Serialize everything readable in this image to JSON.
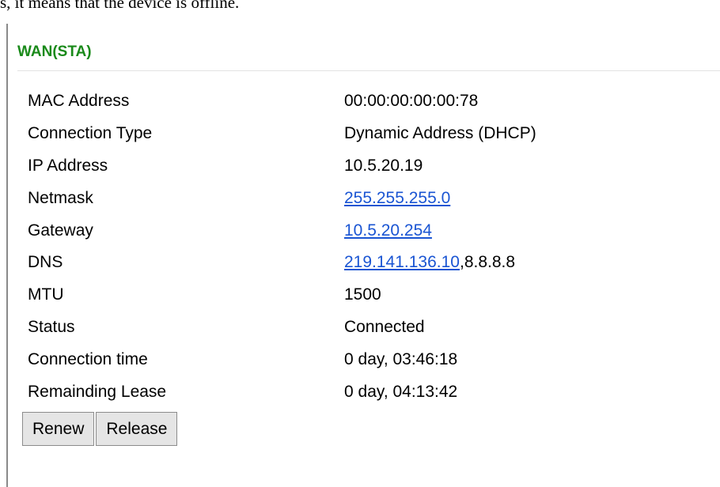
{
  "header_text": "s, it means that the device is offline.",
  "section": {
    "title": "WAN(STA)"
  },
  "rows": [
    {
      "label": "MAC Address",
      "value": "00:00:00:00:00:78"
    },
    {
      "label": "Connection Type",
      "value": "Dynamic Address (DHCP)"
    },
    {
      "label": "IP Address",
      "value": "10.5.20.19"
    },
    {
      "label": "Netmask",
      "value_link": "255.255.255.0"
    },
    {
      "label": "Gateway",
      "value_link": "10.5.20.254"
    },
    {
      "label": "DNS",
      "value_link": "219.141.136.10",
      "value_suffix": ",8.8.8.8"
    },
    {
      "label": "MTU",
      "value": "1500"
    },
    {
      "label": "Status",
      "value": "Connected"
    },
    {
      "label": "Connection time",
      "value": "0 day, 03:46:18"
    },
    {
      "label": "Remainding Lease",
      "value": "0 day, 04:13:42"
    }
  ],
  "buttons": {
    "renew": "Renew",
    "release": "Release"
  },
  "colors": {
    "section_title": "#1a8a1a",
    "link": "#1a55d3",
    "button_bg": "#e5e5e5"
  }
}
